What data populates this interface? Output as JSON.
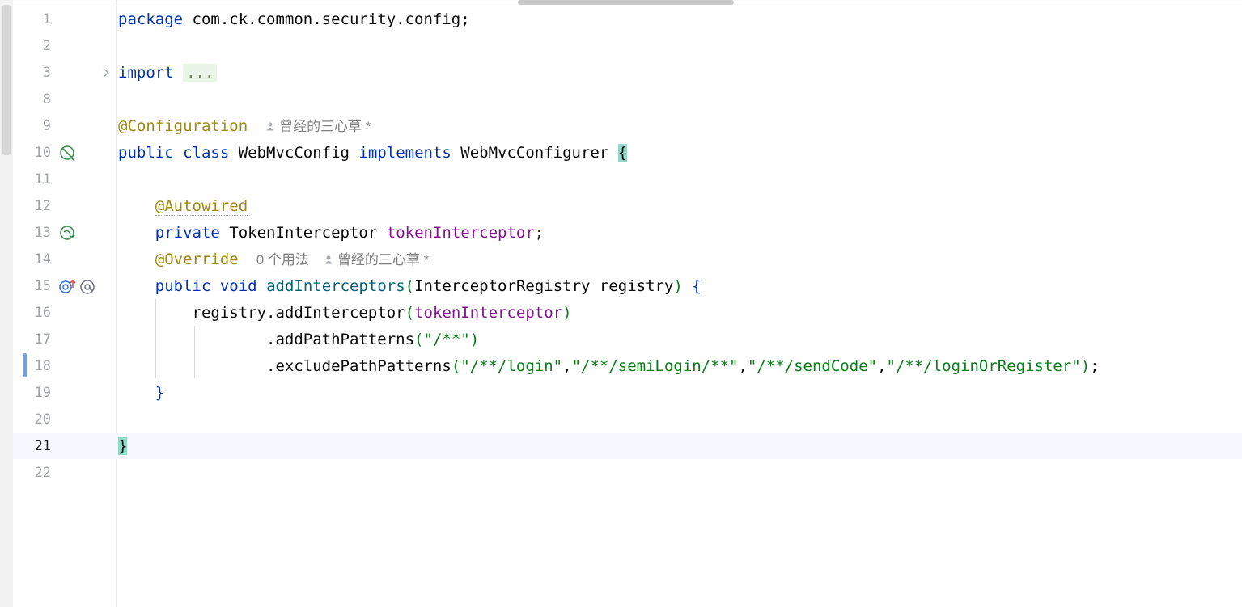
{
  "editor": {
    "lines": [
      {
        "number": "1",
        "segments": [
          {
            "t": "package",
            "c": "kw"
          },
          {
            "t": " com.ck.common.security.config;",
            "c": ""
          }
        ]
      },
      {
        "number": "2",
        "segments": []
      },
      {
        "number": "3",
        "segments": [
          {
            "t": "import",
            "c": "kw"
          },
          {
            "t": " ",
            "c": ""
          },
          {
            "t": "...",
            "c": "fold-hl"
          }
        ],
        "fold": true
      },
      {
        "number": "8",
        "segments": []
      },
      {
        "number": "9",
        "segments": [
          {
            "t": "@Configuration",
            "c": "ann"
          }
        ],
        "inlay": {
          "author": "曾经的三心草 *"
        }
      },
      {
        "number": "10",
        "segments": [
          {
            "t": "public class",
            "c": "kw"
          },
          {
            "t": " WebMvcConfig ",
            "c": ""
          },
          {
            "t": "implements",
            "c": "kw"
          },
          {
            "t": " WebMvcConfigurer ",
            "c": ""
          },
          {
            "t": "{",
            "c": "brace-hl"
          }
        ],
        "icon": "spring-bean-icon"
      },
      {
        "number": "11",
        "segments": []
      },
      {
        "number": "12",
        "segments": [
          {
            "t": "    ",
            "c": ""
          },
          {
            "t": "@Autowired",
            "c": "ann autowired"
          }
        ]
      },
      {
        "number": "13",
        "segments": [
          {
            "t": "    ",
            "c": ""
          },
          {
            "t": "private",
            "c": "kw"
          },
          {
            "t": " TokenInterceptor ",
            "c": ""
          },
          {
            "t": "tokenInterceptor",
            "c": "fld"
          },
          {
            "t": ";",
            "c": ""
          }
        ],
        "icon": "spring-autowired-icon"
      },
      {
        "number": "14",
        "segments": [
          {
            "t": "    ",
            "c": ""
          },
          {
            "t": "@Override",
            "c": "ann"
          }
        ],
        "inlay": {
          "usages": "0 个用法",
          "author": "曾经的三心草 *"
        }
      },
      {
        "number": "15",
        "segments": [
          {
            "t": "    ",
            "c": ""
          },
          {
            "t": "public void",
            "c": "kw"
          },
          {
            "t": " ",
            "c": ""
          },
          {
            "t": "addInterceptors",
            "c": "mth"
          },
          {
            "t": "(",
            "c": "paren"
          },
          {
            "t": "InterceptorRegistry registry",
            "c": ""
          },
          {
            "t": ")",
            "c": "paren"
          },
          {
            "t": " {",
            "c": "kw"
          }
        ],
        "icon": "override-method-icon"
      },
      {
        "number": "16",
        "segments": [
          {
            "t": "        registry.addInterceptor",
            "c": ""
          },
          {
            "t": "(",
            "c": "paren"
          },
          {
            "t": "tokenInterceptor",
            "c": "fld"
          },
          {
            "t": ")",
            "c": "paren"
          }
        ]
      },
      {
        "number": "17",
        "segments": [
          {
            "t": "                .addPathPatterns",
            "c": ""
          },
          {
            "t": "(",
            "c": "paren"
          },
          {
            "t": "\"/**\"",
            "c": "str"
          },
          {
            "t": ")",
            "c": "paren"
          }
        ]
      },
      {
        "number": "18",
        "segments": [
          {
            "t": "                .excludePathPatterns",
            "c": ""
          },
          {
            "t": "(",
            "c": "paren"
          },
          {
            "t": "\"/**/login\"",
            "c": "str"
          },
          {
            "t": ",",
            "c": ""
          },
          {
            "t": "\"/**/semiLogin/**\"",
            "c": "str"
          },
          {
            "t": ",",
            "c": ""
          },
          {
            "t": "\"/**/sendCode\"",
            "c": "str"
          },
          {
            "t": ",",
            "c": ""
          },
          {
            "t": "\"/**/loginOrRegister\"",
            "c": "str"
          },
          {
            "t": ")",
            "c": "paren"
          },
          {
            "t": ";",
            "c": ""
          }
        ]
      },
      {
        "number": "19",
        "segments": [
          {
            "t": "    ",
            "c": ""
          },
          {
            "t": "}",
            "c": "kw"
          }
        ]
      },
      {
        "number": "20",
        "segments": []
      },
      {
        "number": "21",
        "segments": [
          {
            "t": "}",
            "c": "brace-hl"
          }
        ],
        "current": true
      },
      {
        "number": "22",
        "segments": []
      }
    ]
  },
  "colors": {
    "keyword": "#0033b3",
    "annotation": "#9e880d",
    "field": "#871094",
    "string": "#067d17",
    "method": "#00627a",
    "brace_highlight": "#93d9c9",
    "change_marker": "#6f9ef8",
    "current_line": "#f5f8fe"
  }
}
